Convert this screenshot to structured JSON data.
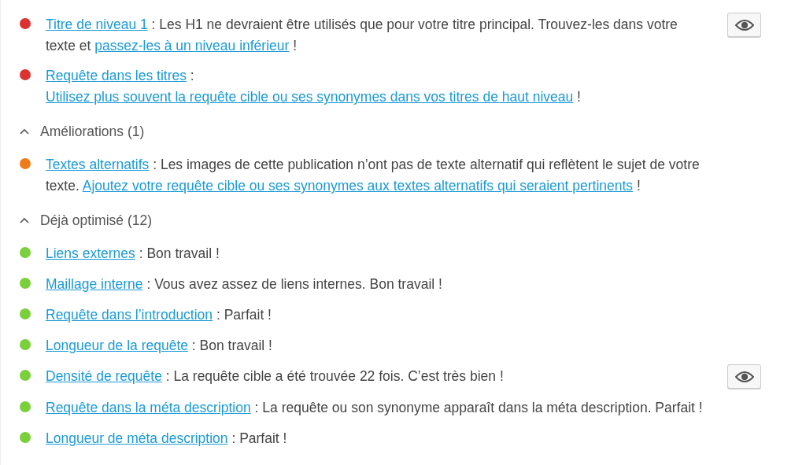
{
  "sections": [
    {
      "items": [
        {
          "color": "#dc3232",
          "marker_button": true,
          "parts": [
            {
              "kind": "link",
              "text": "Titre de niveau 1"
            },
            {
              "kind": "plain",
              "text": " : Les H1 ne devraient être utilisés que pour votre titre principal. Trouvez-les dans votre texte et "
            },
            {
              "kind": "link",
              "text": "passez-les à un niveau inférieur"
            },
            {
              "kind": "plain",
              "text": " !"
            }
          ]
        },
        {
          "color": "#dc3232",
          "marker_button": false,
          "parts": [
            {
              "kind": "link",
              "text": "Requête dans les titres"
            },
            {
              "kind": "plain",
              "text": " : "
            },
            {
              "kind": "link",
              "text": "Utilisez plus souvent la requête cible ou ses synonymes dans vos titres de haut niveau"
            },
            {
              "kind": "plain",
              "text": " !"
            }
          ]
        }
      ]
    },
    {
      "heading": "Améliorations (1)",
      "expanded": true,
      "items": [
        {
          "color": "#ee7c1b",
          "marker_button": false,
          "parts": [
            {
              "kind": "link",
              "text": "Textes alternatifs"
            },
            {
              "kind": "plain",
              "text": " : Les images de cette publication n’ont pas de texte alternatif qui reflètent le sujet de votre texte. "
            },
            {
              "kind": "link",
              "text": "Ajoutez votre requête cible ou ses synonymes aux textes alternatifs qui seraient pertinents"
            },
            {
              "kind": "plain",
              "text": " !"
            }
          ]
        }
      ]
    },
    {
      "heading": "Déjà optimisé (12)",
      "expanded": true,
      "items": [
        {
          "color": "#7ad03a",
          "marker_button": false,
          "parts": [
            {
              "kind": "link",
              "text": "Liens externes"
            },
            {
              "kind": "plain",
              "text": " : Bon travail !"
            }
          ]
        },
        {
          "color": "#7ad03a",
          "marker_button": false,
          "parts": [
            {
              "kind": "link",
              "text": "Maillage interne"
            },
            {
              "kind": "plain",
              "text": " : Vous avez assez de liens internes. Bon travail !"
            }
          ]
        },
        {
          "color": "#7ad03a",
          "marker_button": false,
          "parts": [
            {
              "kind": "link",
              "text": "Requête dans l’introduction"
            },
            {
              "kind": "plain",
              "text": " : Parfait !"
            }
          ]
        },
        {
          "color": "#7ad03a",
          "marker_button": false,
          "parts": [
            {
              "kind": "link",
              "text": "Longueur de la requête"
            },
            {
              "kind": "plain",
              "text": " : Bon travail !"
            }
          ]
        },
        {
          "color": "#7ad03a",
          "marker_button": true,
          "parts": [
            {
              "kind": "link",
              "text": "Densité de requête"
            },
            {
              "kind": "plain",
              "text": " : La requête cible a été trouvée 22 fois. C’est très bien !"
            }
          ]
        },
        {
          "color": "#7ad03a",
          "marker_button": false,
          "parts": [
            {
              "kind": "link",
              "text": "Requête dans la méta description"
            },
            {
              "kind": "plain",
              "text": " : La requête ou son synonyme apparaît dans la méta description. Parfait !"
            }
          ]
        },
        {
          "color": "#7ad03a",
          "marker_button": false,
          "parts": [
            {
              "kind": "link",
              "text": "Longueur de méta description"
            },
            {
              "kind": "plain",
              "text": " : Parfait !"
            }
          ]
        }
      ]
    }
  ]
}
